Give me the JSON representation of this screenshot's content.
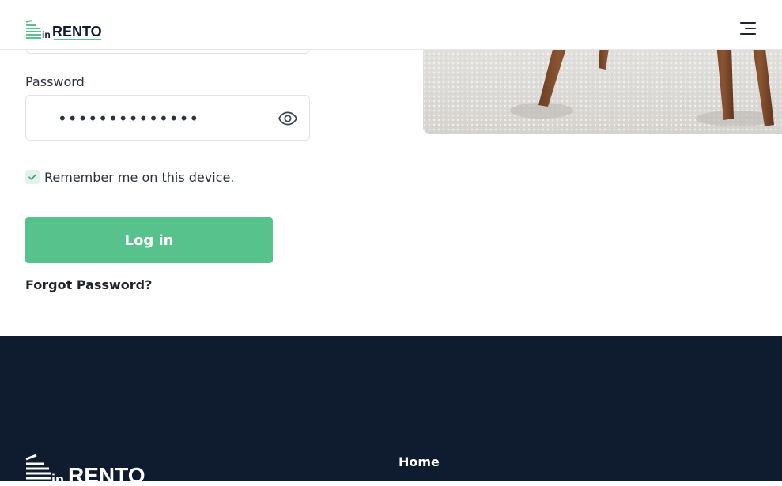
{
  "header": {
    "logo_text": "inRENTO",
    "menu_icon": "hamburger-menu-icon"
  },
  "form": {
    "password_label": "Password",
    "password_value": "••••••••••••••",
    "remember_label": "Remember me on this device.",
    "remember_checked": true,
    "login_label": "Log in",
    "forgot_label": "Forgot Password?"
  },
  "footer": {
    "logo_text": "inRENTO",
    "nav": {
      "home": "Home"
    }
  },
  "colors": {
    "accent": "#58c28c",
    "footer_bg": "#0f1b2e",
    "text": "#1f2430"
  }
}
